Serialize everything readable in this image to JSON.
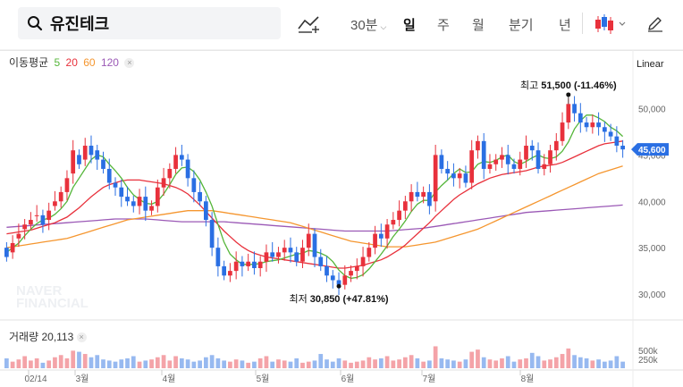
{
  "search": {
    "query": "유진테크"
  },
  "periods": {
    "minute": "30분",
    "day": "일",
    "week": "주",
    "month": "월",
    "quarter": "분기",
    "year": "년"
  },
  "ma_legend": {
    "title": "이동평균",
    "p5": "5",
    "p20": "20",
    "p60": "60",
    "p120": "120"
  },
  "scale": "Linear",
  "volume_legend": {
    "label": "거래량",
    "value": "20,113"
  },
  "colors": {
    "up": "#e8313c",
    "down": "#2a6fe3",
    "ma5": "#55b63a",
    "ma20": "#e8313c",
    "ma60": "#f5962f",
    "ma120": "#9b59b6",
    "current_price_bg": "#2a6fe3"
  },
  "watermark": "NAVER FINANCIAL",
  "chart_data": {
    "type": "candlestick",
    "y_axis": {
      "ticks": [
        "50,000",
        "45,000",
        "40,000",
        "35,000",
        "30,000"
      ],
      "tick_values": [
        50000,
        45000,
        40000,
        35000,
        30000
      ],
      "range": [
        27500,
        54000
      ]
    },
    "volume_axis": {
      "ticks": [
        "500k",
        "250k"
      ]
    },
    "x_axis": {
      "labels": [
        "02/14",
        "3월",
        "4월",
        "5월",
        "6월",
        "7월",
        "8월"
      ]
    },
    "high_annotation": {
      "label": "최고",
      "price": "51,500",
      "change": "(-11.46%)",
      "value": 51500
    },
    "low_annotation": {
      "label": "최저",
      "price": "30,850",
      "change": "(+47.81%)",
      "value": 30850
    },
    "current_price": {
      "value": 45600,
      "label": "45,600"
    },
    "closes": [
      34000,
      35500,
      36500,
      37500,
      38000,
      38500,
      37500,
      39000,
      40000,
      41000,
      42500,
      45500,
      44000,
      46000,
      45000,
      44500,
      43500,
      42000,
      41500,
      40500,
      40000,
      39500,
      40500,
      39000,
      39500,
      41500,
      42500,
      43500,
      45000,
      44500,
      42500,
      41000,
      40000,
      38000,
      35000,
      33000,
      32000,
      32500,
      33500,
      33000,
      33500,
      32800,
      33500,
      34500,
      34000,
      34500,
      35000,
      34500,
      33500,
      35000,
      36500,
      34000,
      33000,
      32000,
      31500,
      31000,
      32000,
      32500,
      33000,
      34000,
      35000,
      36500,
      36000,
      37500,
      38000,
      39000,
      40000,
      41000,
      40500,
      41000,
      39500,
      45000,
      43500,
      43000,
      42500,
      43000,
      42000,
      45500,
      46500,
      43500,
      44000,
      44500,
      45000,
      44000,
      43500,
      44500,
      46000,
      45500,
      43500,
      44000,
      45500,
      46500,
      48500,
      50500,
      49500,
      48500,
      48000,
      48500,
      48000,
      47500,
      47000,
      46000,
      45600
    ],
    "opens": [
      35000,
      34500,
      36000,
      37000,
      37500,
      38500,
      38500,
      38000,
      39500,
      40000,
      41000,
      43000,
      45000,
      44500,
      46000,
      45500,
      44500,
      43500,
      42000,
      41500,
      40500,
      40000,
      39500,
      40500,
      39000,
      39500,
      41500,
      42500,
      43500,
      45000,
      44500,
      42500,
      41000,
      40000,
      38000,
      35000,
      33000,
      32000,
      32500,
      33500,
      33000,
      33500,
      32800,
      33500,
      34500,
      34000,
      34500,
      35000,
      34500,
      33500,
      35000,
      36500,
      34000,
      33000,
      32000,
      31500,
      31000,
      32000,
      32500,
      33000,
      34000,
      35000,
      36500,
      36000,
      37500,
      38000,
      39000,
      40000,
      41000,
      40500,
      41000,
      40000,
      45000,
      43500,
      43000,
      42500,
      43000,
      42000,
      45500,
      46500,
      43500,
      44000,
      44500,
      45000,
      44000,
      43500,
      44500,
      46000,
      45500,
      43500,
      44000,
      45500,
      46500,
      48500,
      50500,
      49500,
      48500,
      48000,
      48500,
      48000,
      47500,
      47000,
      46000
    ],
    "ma5": [
      34500,
      35000,
      35500,
      36300,
      37000,
      37600,
      38000,
      38200,
      38600,
      39200,
      40000,
      41500,
      42500,
      43500,
      44500,
      45000,
      44800,
      44000,
      43300,
      42500,
      41500,
      40700,
      40200,
      39800,
      39700,
      40000,
      40800,
      41800,
      42900,
      43600,
      43700,
      43200,
      42300,
      41000,
      39500,
      37500,
      35600,
      34300,
      33700,
      33200,
      33200,
      33200,
      33300,
      33500,
      33600,
      33700,
      33900,
      34100,
      34300,
      34400,
      34700,
      34600,
      34400,
      34100,
      33500,
      32600,
      32000,
      31700,
      31800,
      32100,
      32700,
      33500,
      34300,
      35200,
      36200,
      37000,
      37900,
      38900,
      39700,
      40100,
      40100,
      41000,
      41700,
      42300,
      43000,
      43500,
      43100,
      43200,
      44000,
      44300,
      44200,
      44400,
      44800,
      45000,
      44300,
      44000,
      44300,
      44700,
      45000,
      44700,
      44600,
      44800,
      45400,
      46400,
      47800,
      48700,
      49300,
      49300,
      49000,
      48600,
      48000,
      47600,
      47000
    ],
    "ma20": [
      36500,
      36600,
      36700,
      36800,
      36900,
      37100,
      37300,
      37500,
      37700,
      38000,
      38300,
      38800,
      39300,
      39900,
      40500,
      41000,
      41500,
      41800,
      42000,
      42200,
      42300,
      42300,
      42300,
      42200,
      42100,
      42000,
      41900,
      41700,
      41500,
      41200,
      40800,
      40200,
      39600,
      38900,
      38200,
      37500,
      36800,
      36200,
      35600,
      35100,
      34700,
      34400,
      34200,
      34000,
      33900,
      33800,
      33700,
      33600,
      33500,
      33400,
      33300,
      33200,
      33100,
      33000,
      32900,
      32800,
      32800,
      32900,
      33000,
      33100,
      33300,
      33500,
      33700,
      34000,
      34400,
      34800,
      35300,
      35900,
      36500,
      37100,
      37700,
      38400,
      39000,
      39600,
      40200,
      40700,
      41100,
      41500,
      41900,
      42200,
      42500,
      42700,
      42900,
      43000,
      43100,
      43200,
      43300,
      43500,
      43700,
      43800,
      43900,
      44000,
      44200,
      44500,
      44800,
      45100,
      45400,
      45700,
      46000,
      46200,
      46300,
      46400,
      46500
    ],
    "ma60": [
      35000,
      35100,
      35200,
      35300,
      35400,
      35500,
      35600,
      35700,
      35800,
      35900,
      36000,
      36200,
      36400,
      36600,
      36800,
      37000,
      37200,
      37400,
      37600,
      37800,
      38000,
      38100,
      38200,
      38300,
      38400,
      38500,
      38600,
      38700,
      38800,
      38900,
      39000,
      39000,
      39000,
      39000,
      39000,
      38900,
      38800,
      38700,
      38600,
      38500,
      38400,
      38300,
      38200,
      38100,
      38000,
      37900,
      37800,
      37700,
      37500,
      37300,
      37100,
      36900,
      36700,
      36500,
      36300,
      36100,
      35900,
      35700,
      35600,
      35500,
      35400,
      35300,
      35200,
      35100,
      35100,
      35100,
      35100,
      35200,
      35300,
      35400,
      35500,
      35600,
      35800,
      36000,
      36200,
      36400,
      36600,
      36800,
      37000,
      37300,
      37600,
      37900,
      38200,
      38500,
      38800,
      39100,
      39400,
      39700,
      40000,
      40300,
      40600,
      40900,
      41200,
      41500,
      41800,
      42100,
      42400,
      42700,
      43000,
      43200,
      43400,
      43600,
      43800
    ],
    "ma120": [
      37200,
      37250,
      37300,
      37350,
      37400,
      37450,
      37500,
      37550,
      37600,
      37650,
      37700,
      37750,
      37800,
      37850,
      37900,
      37950,
      38000,
      38050,
      38100,
      38100,
      38100,
      38100,
      38100,
      38100,
      38050,
      38000,
      37950,
      37900,
      37850,
      37800,
      37800,
      37800,
      37800,
      37800,
      37800,
      37800,
      37800,
      37750,
      37700,
      37650,
      37600,
      37550,
      37500,
      37450,
      37400,
      37350,
      37300,
      37250,
      37200,
      37150,
      37100,
      37050,
      37000,
      36950,
      36900,
      36850,
      36800,
      36800,
      36800,
      36800,
      36800,
      36800,
      36800,
      36800,
      36850,
      36900,
      36950,
      37000,
      37050,
      37100,
      37200,
      37300,
      37400,
      37500,
      37600,
      37700,
      37800,
      37900,
      38000,
      38100,
      38200,
      38300,
      38400,
      38500,
      38600,
      38700,
      38800,
      38850,
      38900,
      38950,
      39000,
      39050,
      39100,
      39150,
      39200,
      39250,
      39300,
      39350,
      39400,
      39450,
      39500,
      39550,
      39600
    ],
    "volume": [
      90,
      60,
      80,
      110,
      70,
      90,
      50,
      70,
      100,
      120,
      90,
      160,
      150,
      130,
      100,
      120,
      80,
      70,
      60,
      80,
      90,
      110,
      60,
      70,
      80,
      100,
      120,
      70,
      110,
      90,
      80,
      60,
      70,
      100,
      120,
      90,
      70,
      60,
      80,
      70,
      50,
      60,
      90,
      110,
      60,
      80,
      70,
      60,
      90,
      50,
      60,
      70,
      130,
      80,
      60,
      90,
      70,
      50,
      60,
      70,
      100,
      80,
      90,
      110,
      70,
      80,
      100,
      120,
      90,
      60,
      70,
      200,
      90,
      80,
      70,
      60,
      80,
      150,
      170,
      100,
      80,
      70,
      90,
      110,
      60,
      80,
      90,
      140,
      110,
      70,
      80,
      100,
      130,
      180,
      120,
      100,
      90,
      70,
      80,
      60,
      70,
      110,
      60
    ]
  }
}
